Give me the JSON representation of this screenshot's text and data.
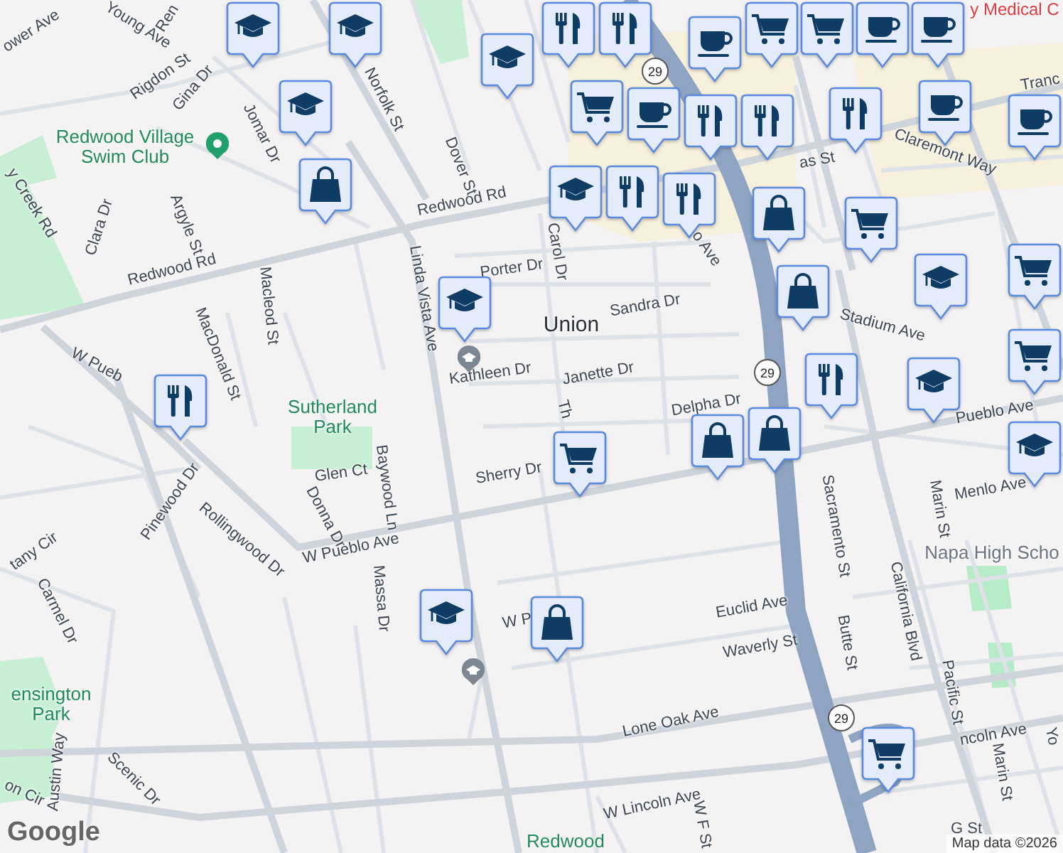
{
  "map": {
    "labels": [
      {
        "text": "ower Ave",
        "kind": "street"
      },
      {
        "text": "Young Ave",
        "kind": "street"
      },
      {
        "text": "Ren",
        "kind": "street"
      },
      {
        "text": "Rigdon St",
        "kind": "street"
      },
      {
        "text": "Gina Dr",
        "kind": "street"
      },
      {
        "text": "Norfolk St",
        "kind": "street"
      },
      {
        "text": "Jomar Dr",
        "kind": "street"
      },
      {
        "text": "Dover St",
        "kind": "street"
      },
      {
        "text": "Redwood Village Swim Club",
        "kind": "poi"
      },
      {
        "text": "Redwood Rd",
        "kind": "street"
      },
      {
        "text": "y Creek Rd",
        "kind": "street"
      },
      {
        "text": "Clara Dr",
        "kind": "street"
      },
      {
        "text": "Argyle St",
        "kind": "street"
      },
      {
        "text": "Redwood Rd",
        "kind": "street"
      },
      {
        "text": "Carol Dr",
        "kind": "street"
      },
      {
        "text": "Macleod St",
        "kind": "street"
      },
      {
        "text": "MacDonald St",
        "kind": "street"
      },
      {
        "text": "Linda Vista Ave",
        "kind": "street"
      },
      {
        "text": "Porter Dr",
        "kind": "street"
      },
      {
        "text": "Kathleen Dr",
        "kind": "street"
      },
      {
        "text": "W Pueb",
        "kind": "street"
      },
      {
        "text": "Sutherland Park",
        "kind": "park"
      },
      {
        "text": "Union",
        "kind": "district"
      },
      {
        "text": "Sandra Dr",
        "kind": "street"
      },
      {
        "text": "Janette Dr",
        "kind": "street"
      },
      {
        "text": "Delpha Dr",
        "kind": "street"
      },
      {
        "text": "Stadium Ave",
        "kind": "street"
      },
      {
        "text": "Claremont Way",
        "kind": "street"
      },
      {
        "text": "as St",
        "kind": "street"
      },
      {
        "text": "Tranc",
        "kind": "street"
      },
      {
        "text": "y Medical C",
        "kind": "hospital"
      },
      {
        "text": "o Ave",
        "kind": "street"
      },
      {
        "text": "Pueblo Ave",
        "kind": "street"
      },
      {
        "text": "Th",
        "kind": "street"
      },
      {
        "text": "Sherry Dr",
        "kind": "street"
      },
      {
        "text": "Glen Ct",
        "kind": "street"
      },
      {
        "text": "Baywood Ln",
        "kind": "street"
      },
      {
        "text": "Pinewood Dr",
        "kind": "street"
      },
      {
        "text": "Rollingwood Dr",
        "kind": "street"
      },
      {
        "text": "Donna Dr",
        "kind": "street"
      },
      {
        "text": "W Pueblo Ave",
        "kind": "street"
      },
      {
        "text": "Massa Dr",
        "kind": "street"
      },
      {
        "text": "tany Cir",
        "kind": "street"
      },
      {
        "text": "Carmel Dr",
        "kind": "street"
      },
      {
        "text": "ensington Park",
        "kind": "park"
      },
      {
        "text": "Austin Way",
        "kind": "street"
      },
      {
        "text": "on Cir",
        "kind": "street"
      },
      {
        "text": "Scenic Dr",
        "kind": "street"
      },
      {
        "text": "W P",
        "kind": "street"
      },
      {
        "text": "Menlo Ave",
        "kind": "street"
      },
      {
        "text": "Napa High Scho",
        "kind": "school"
      },
      {
        "text": "Marin St",
        "kind": "street"
      },
      {
        "text": "Sacramento St",
        "kind": "street"
      },
      {
        "text": "Euclid Ave",
        "kind": "street"
      },
      {
        "text": "Waverly St",
        "kind": "street"
      },
      {
        "text": "Butte St",
        "kind": "street"
      },
      {
        "text": "California Blvd",
        "kind": "street"
      },
      {
        "text": "Pacific St",
        "kind": "street"
      },
      {
        "text": "Lone Oak Ave",
        "kind": "street"
      },
      {
        "text": "ncoln Ave",
        "kind": "street"
      },
      {
        "text": "Marin St",
        "kind": "street"
      },
      {
        "text": "Yo",
        "kind": "street"
      },
      {
        "text": "W Lincoln Ave",
        "kind": "street"
      },
      {
        "text": "W F St",
        "kind": "street"
      },
      {
        "text": "Redwood",
        "kind": "park"
      },
      {
        "text": "G St",
        "kind": "street"
      }
    ],
    "route_shields": [
      "29",
      "29",
      "29"
    ],
    "pins": [
      {
        "kind": "school"
      },
      {
        "kind": "school"
      },
      {
        "kind": "school"
      },
      {
        "kind": "school"
      },
      {
        "kind": "shopping"
      },
      {
        "kind": "restaurant"
      },
      {
        "kind": "restaurant"
      },
      {
        "kind": "grocery"
      },
      {
        "kind": "grocery"
      },
      {
        "kind": "cafe"
      },
      {
        "kind": "cafe"
      },
      {
        "kind": "cafe"
      },
      {
        "kind": "grocery"
      },
      {
        "kind": "cafe"
      },
      {
        "kind": "restaurant"
      },
      {
        "kind": "restaurant"
      },
      {
        "kind": "restaurant"
      },
      {
        "kind": "cafe"
      },
      {
        "kind": "cafe"
      },
      {
        "kind": "school"
      },
      {
        "kind": "restaurant"
      },
      {
        "kind": "restaurant"
      },
      {
        "kind": "shopping"
      },
      {
        "kind": "grocery"
      },
      {
        "kind": "shopping"
      },
      {
        "kind": "school"
      },
      {
        "kind": "school"
      },
      {
        "kind": "grocery"
      },
      {
        "kind": "grocery"
      },
      {
        "kind": "restaurant"
      },
      {
        "kind": "restaurant"
      },
      {
        "kind": "school"
      },
      {
        "kind": "school"
      },
      {
        "kind": "shopping"
      },
      {
        "kind": "shopping"
      },
      {
        "kind": "grocery"
      },
      {
        "kind": "school"
      },
      {
        "kind": "shopping"
      },
      {
        "kind": "grocery"
      }
    ]
  },
  "attribution": {
    "logo": "Google",
    "text": "Map data ©2026"
  }
}
